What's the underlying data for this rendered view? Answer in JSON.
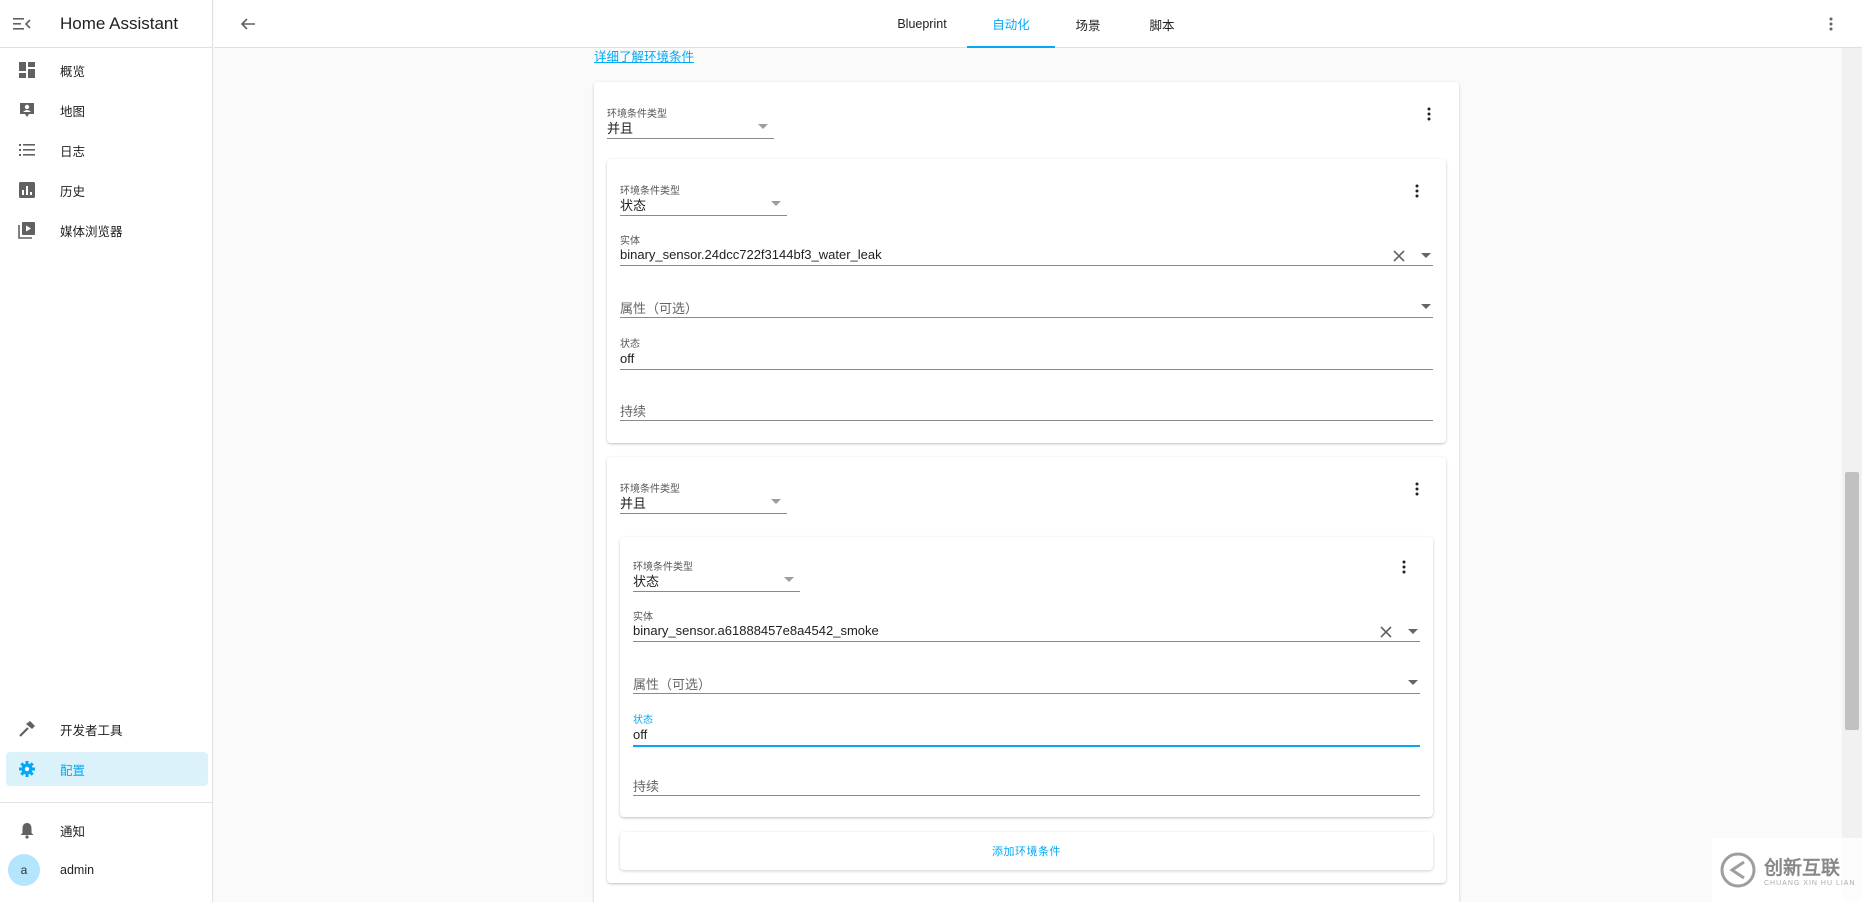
{
  "app": {
    "title": "Home Assistant"
  },
  "sidebar": {
    "items": [
      {
        "label": "概览",
        "icon": "dashboard-icon"
      },
      {
        "label": "地图",
        "icon": "map-account-icon"
      },
      {
        "label": "日志",
        "icon": "format-list-icon"
      },
      {
        "label": "历史",
        "icon": "chart-box-icon"
      },
      {
        "label": "媒体浏览器",
        "icon": "play-box-multiple-icon"
      }
    ],
    "bottom_items": [
      {
        "label": "开发者工具",
        "icon": "hammer-icon"
      },
      {
        "label": "配置",
        "icon": "cog-icon",
        "active": true
      }
    ],
    "notifications": {
      "label": "通知",
      "icon": "bell-icon"
    },
    "user": {
      "label": "admin",
      "avatar_letter": "a"
    }
  },
  "topbar": {
    "tabs": [
      {
        "label": "Blueprint"
      },
      {
        "label": "自动化",
        "active": true
      },
      {
        "label": "场景"
      },
      {
        "label": "脚本"
      }
    ]
  },
  "content": {
    "learn_more_link": "详细了解环境条件",
    "outer_condition": {
      "type_label": "环境条件类型",
      "type_value": "并且"
    },
    "condition1": {
      "type_label": "环境条件类型",
      "type_value": "状态",
      "entity_label": "实体",
      "entity_value": "binary_sensor.24dcc722f3144bf3_water_leak",
      "attribute_placeholder": "属性（可选）",
      "state_label": "状态",
      "state_value": "off",
      "duration_placeholder": "持续"
    },
    "condition2": {
      "type_label": "环境条件类型",
      "type_value": "并且",
      "inner": {
        "type_label": "环境条件类型",
        "type_value": "状态",
        "entity_label": "实体",
        "entity_value": "binary_sensor.a61888457e8a4542_smoke",
        "attribute_placeholder": "属性（可选）",
        "state_label": "状态",
        "state_value": "off",
        "duration_placeholder": "持续"
      },
      "add_button": "添加环境条件"
    }
  },
  "watermark": {
    "big": "创新互联",
    "small": "CHUANG XIN HU LIAN"
  },
  "colors": {
    "accent": "#03a9f4",
    "active_bg": "#dbf2fb"
  }
}
